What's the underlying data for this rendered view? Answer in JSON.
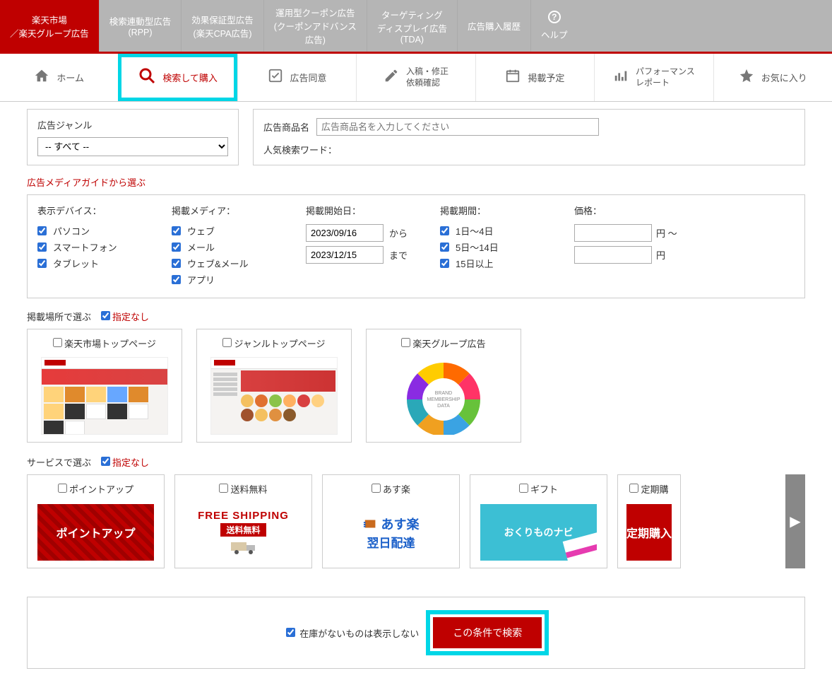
{
  "topnav": {
    "tabs": [
      {
        "line1": "楽天市場",
        "line2": "／楽天グループ広告",
        "active": true
      },
      {
        "line1": "検索連動型広告",
        "line2": "(RPP)"
      },
      {
        "line1": "効果保証型広告",
        "line2": "(楽天CPA広告)"
      },
      {
        "line1": "運用型クーポン広告",
        "line2": "(クーポンアドバンス",
        "line3": "広告)"
      },
      {
        "line1": "ターゲティング",
        "line2": "ディスプレイ広告",
        "line3": "(TDA)"
      },
      {
        "line1": "広告購入履歴"
      }
    ],
    "help": "ヘルプ"
  },
  "subnav": {
    "home": "ホーム",
    "search": "検索して購入",
    "consent": "広告同意",
    "edit1": "入稿・修正",
    "edit2": "依頼確認",
    "schedule": "掲載予定",
    "perf1": "パフォーマンス",
    "perf2": "レポート",
    "fav": "お気に入り"
  },
  "filters": {
    "genre_label": "広告ジャンル",
    "genre_value": "-- すべて --",
    "name_label": "広告商品名",
    "name_placeholder": "広告商品名を入力してください",
    "popular_label": "人気検索ワード："
  },
  "media_title": "広告メディアガイドから選ぶ",
  "media": {
    "device_label": "表示デバイス：",
    "devices": [
      "パソコン",
      "スマートフォン",
      "タブレット"
    ],
    "media_label": "掲載メディア：",
    "medias": [
      "ウェブ",
      "メール",
      "ウェブ&メール",
      "アプリ"
    ],
    "start_label": "掲載開始日：",
    "date_from": "2023/09/16",
    "from_sfx": "から",
    "date_to": "2023/12/15",
    "to_sfx": "まで",
    "period_label": "掲載期間：",
    "periods": [
      "1日〜4日",
      "5日〜14日",
      "15日以上"
    ],
    "price_label": "価格：",
    "price_sfx1": "円 〜",
    "price_sfx2": "円"
  },
  "placement": {
    "title": "掲載場所で選ぶ",
    "nospec": "指定なし",
    "cards": [
      "楽天市場トップページ",
      "ジャンルトップページ",
      "楽天グループ広告"
    ],
    "wheel_txt1": "BRAND",
    "wheel_txt2": "MEMBERSHIP",
    "wheel_txt3": "DATA"
  },
  "service": {
    "title": "サービスで選ぶ",
    "nospec": "指定なし",
    "cards": [
      {
        "label": "ポイントアップ"
      },
      {
        "label": "送料無料"
      },
      {
        "label": "あす楽"
      },
      {
        "label": "ギフト"
      },
      {
        "label": "定期購"
      }
    ],
    "pointup": "ポイントアップ",
    "freeship_en": "FREE SHIPPING",
    "freeship_jp": "送料無料",
    "asuraku1": "あす楽",
    "asuraku2": "翌日配達",
    "gift": "おくりものナビ",
    "teiki": "定期購入"
  },
  "footer": {
    "hide_oos": "在庫がないものは表示しない",
    "search_btn": "この条件で検索"
  }
}
